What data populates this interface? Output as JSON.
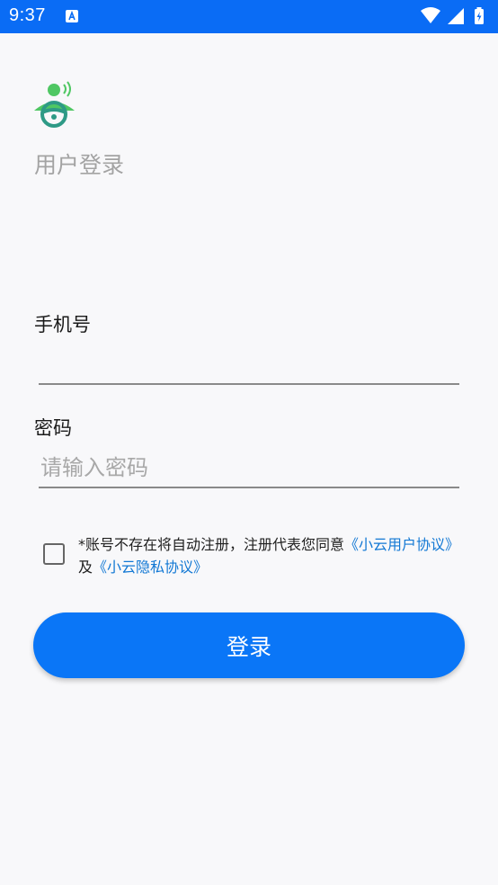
{
  "status_bar": {
    "time": "9:37",
    "notification_icon": "app-notification-icon",
    "icons": [
      "wifi-icon",
      "cell-signal-icon",
      "battery-charging-icon"
    ],
    "background": "#0a6cf5"
  },
  "app": {
    "logo_icon": "driver-steering-wheel-logo",
    "title": "用户登录"
  },
  "form": {
    "phone_label": "手机号",
    "phone_value": "",
    "phone_placeholder": "",
    "password_label": "密码",
    "password_value": "",
    "password_placeholder": "请输入密码"
  },
  "agreement": {
    "checked": false,
    "text_before": "*账号不存在将自动注册，注册代表您同意",
    "link1": "《小云用户协议》",
    "joiner": "及",
    "link2": "《小云隐私协议》",
    "link_color": "#1278d4"
  },
  "login_button": {
    "label": "登录",
    "color": "#0a76f7"
  }
}
